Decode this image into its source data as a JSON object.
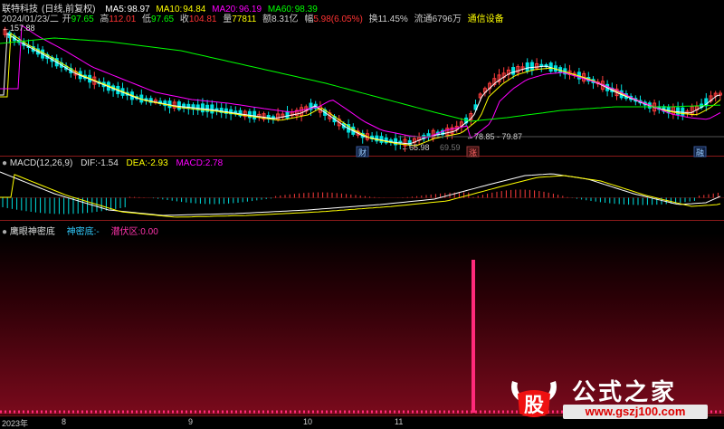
{
  "header": {
    "stock_name": "联特科技",
    "period": "(日线,前复权)",
    "date": "2024/01/23/二",
    "open_label": "开",
    "open": "97.65",
    "high_label": "高",
    "high": "112.01",
    "low_label": "低",
    "low": "97.65",
    "close_label": "收",
    "close": "104.81",
    "vol_label": "量",
    "volume": "77811",
    "amt_label": "额",
    "amount": "8.31亿",
    "chg_label": "幅",
    "change": "5.98(6.05%)",
    "turn_label": "换",
    "turnover": "11.45%",
    "float_label": "流通",
    "float": "6796万",
    "sector": "通信设备"
  },
  "ma": {
    "ma5_label": "MA5:",
    "ma5": "98.97",
    "ma10_label": "MA10:",
    "ma10": "94.84",
    "ma20_label": "MA20:",
    "ma20": "96.19",
    "ma60_label": "MA60:",
    "ma60": "98.39"
  },
  "price_labels": {
    "top_marker": "157.88",
    "low_marker": "65.98",
    "low_marker_b": "69.59",
    "range_marker": "78.85 - 79.87"
  },
  "event_tags": {
    "fin": "财",
    "up": "涨",
    "fin2": "融"
  },
  "macd": {
    "title": "MACD(12,26,9)",
    "dif_label": "DIF:",
    "dif": "-1.54",
    "dea_label": "DEA:",
    "dea": "-2.93",
    "macd_label": "MACD:",
    "macd": "2.78"
  },
  "indicator": {
    "title": "鹰眼神密底",
    "shen_label": "神密底:",
    "shen_value": "-",
    "qian_label": "潜伏区:",
    "qian_value": "0.00"
  },
  "x_axis": {
    "year": "2023年",
    "months": [
      "8",
      "9",
      "10",
      "11"
    ]
  },
  "watermark": {
    "logo_char": "股",
    "site_name": "公式之家",
    "url": "www.gszj100.com"
  },
  "colors": {
    "up": "#ff3c3c",
    "down": "#00e0e0",
    "ma5": "#ffffff",
    "ma10": "#ffff00",
    "ma20": "#ff00ff",
    "ma60": "#00ff00",
    "signal": "#ff2a7a"
  }
}
